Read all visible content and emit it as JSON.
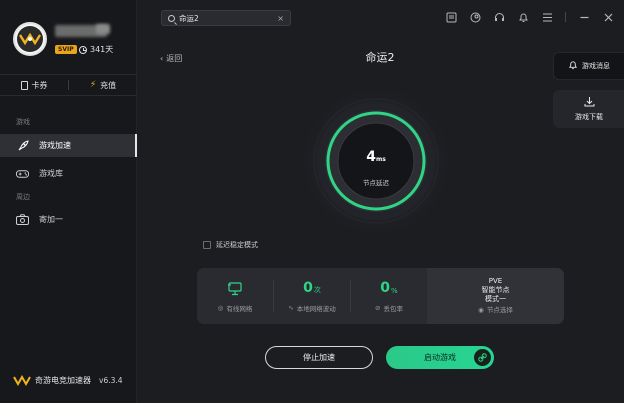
{
  "user": {
    "vip_badge": "SVIP",
    "days": "341天"
  },
  "quick_actions": [
    {
      "label": "卡券",
      "icon": "card-icon"
    },
    {
      "label": "充值",
      "icon": "bolt-icon"
    }
  ],
  "sidebar": {
    "section_game": "游戏",
    "section_around": "周边",
    "items": [
      {
        "label": "游戏加速",
        "icon": "rocket-icon",
        "active": true
      },
      {
        "label": "游戏库",
        "icon": "gamepad-icon",
        "active": false
      },
      {
        "label": "寄加一",
        "icon": "camera-icon",
        "active": false
      }
    ]
  },
  "brand": {
    "name": "奇游电竞加速器",
    "version": "v6.3.4"
  },
  "search": {
    "value": "命运2"
  },
  "main": {
    "back_label": "返回",
    "game_title": "命运2",
    "latency_value": "4",
    "latency_unit": "ms",
    "latency_label": "节点延迟",
    "stable_mode_label": "延迟稳定模式"
  },
  "right_panel": {
    "news_label": "游戏消息",
    "download_label": "游戏下载"
  },
  "stats": {
    "wired_label": "有线网络",
    "local_value": "0",
    "local_unit": "次",
    "local_label": "本地网络波动",
    "loss_value": "0",
    "loss_unit": "%",
    "loss_label": "丢包率",
    "pve_line1": "PVE",
    "pve_line2": "智能节点",
    "pve_line3": "模式一",
    "node_label": "节点选择"
  },
  "buttons": {
    "stop": "停止加速",
    "start": "启动游戏"
  },
  "colors": {
    "accent": "#2fd587",
    "vip": "#e6a51c",
    "bg": "#1c1d21"
  }
}
